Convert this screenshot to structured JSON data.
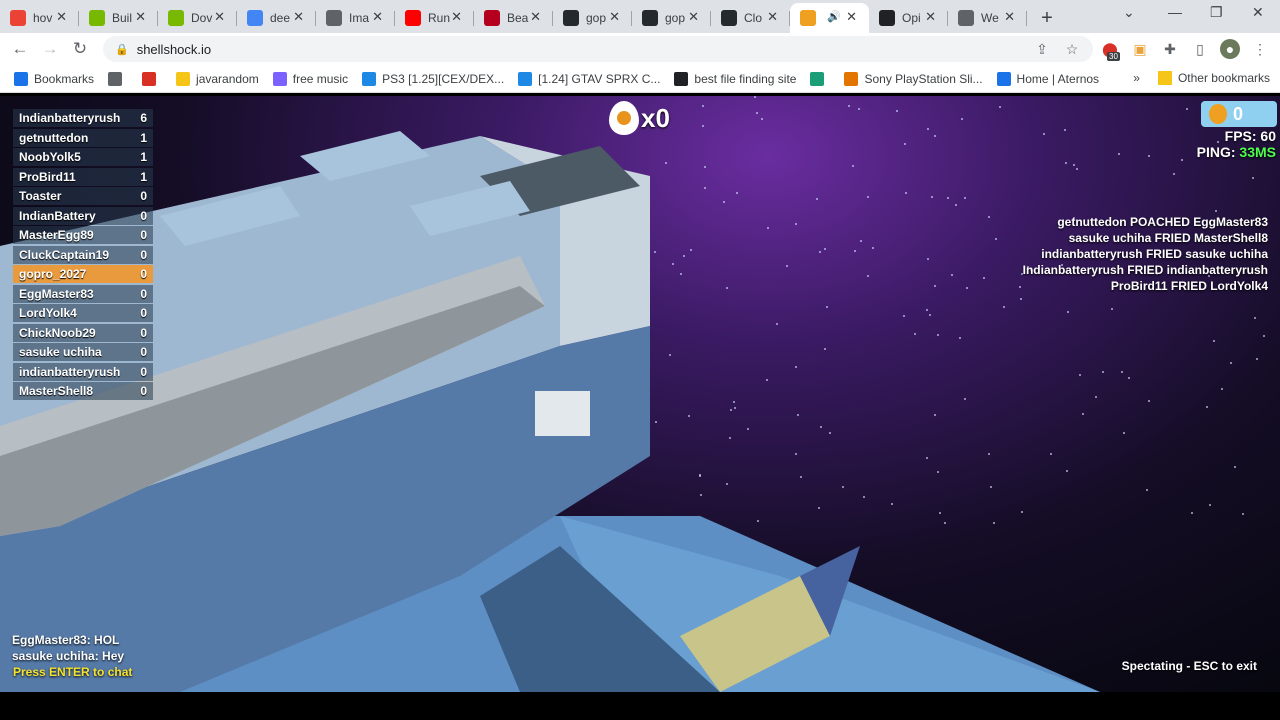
{
  "tabs": [
    {
      "label": "hov",
      "favicon": "google-photos-icon",
      "color": "#ea4335"
    },
    {
      "label": "Buil",
      "favicon": "nvidia-icon",
      "color": "#76b900"
    },
    {
      "label": "Dov",
      "favicon": "nvidia-icon",
      "color": "#76b900"
    },
    {
      "label": "dee",
      "favicon": "google-icon",
      "color": "#4285f4"
    },
    {
      "label": "Ima",
      "favicon": "chart-icon",
      "color": "#5f6368"
    },
    {
      "label": "Run",
      "favicon": "youtube-icon",
      "color": "#ff0000"
    },
    {
      "label": "Bea",
      "favicon": "m-icon",
      "color": "#b4001e"
    },
    {
      "label": "gop",
      "favicon": "github-icon",
      "color": "#24292e"
    },
    {
      "label": "gop",
      "favicon": "github-icon",
      "color": "#24292e"
    },
    {
      "label": "Clo",
      "favicon": "github-icon",
      "color": "#24292e"
    },
    {
      "label": "",
      "favicon": "shellshock-icon",
      "color": "#f0a020",
      "active": true
    },
    {
      "label": "Opi",
      "favicon": "openai-icon",
      "color": "#202124"
    },
    {
      "label": "We",
      "favicon": "globe-icon",
      "color": "#5f6368"
    }
  ],
  "address_bar": {
    "url": "shellshock.io"
  },
  "extension_badge": "30",
  "bookmarks": [
    {
      "label": "Bookmarks",
      "icon": "star-icon",
      "color": "#1a73e8"
    },
    {
      "label": "",
      "icon": "globe-icon",
      "color": "#5f6368"
    },
    {
      "label": "",
      "icon": "heart-icon",
      "color": "#d93025"
    },
    {
      "label": "javarandom",
      "icon": "folder-icon",
      "color": "#f5c518"
    },
    {
      "label": "free music",
      "icon": "diamond-icon",
      "color": "#7b61ff"
    },
    {
      "label": "PS3 [1.25][CEX/DEX...",
      "icon": "c-icon",
      "color": "#1e88e5"
    },
    {
      "label": "[1.24] GTAV SPRX C...",
      "icon": "c-icon",
      "color": "#1e88e5"
    },
    {
      "label": "best file finding site",
      "icon": "robot-icon",
      "color": "#202124"
    },
    {
      "label": "",
      "icon": "app-icon",
      "color": "#1b9e77"
    },
    {
      "label": "Sony PlayStation Sli...",
      "icon": "bag-icon",
      "color": "#e37400"
    },
    {
      "label": "Home | Aternos",
      "icon": "aternos-icon",
      "color": "#1a73e8"
    }
  ],
  "other_bookmarks": "Other bookmarks",
  "leaderboard": [
    {
      "name": "Indianbatteryrush",
      "score": "6"
    },
    {
      "name": "getnuttedon",
      "score": "1"
    },
    {
      "name": "NoobYolk5",
      "score": "1"
    },
    {
      "name": "ProBird11",
      "score": "1"
    },
    {
      "name": "Toaster",
      "score": "0"
    },
    {
      "name": "IndianBattery",
      "score": "0"
    },
    {
      "name": "MasterEgg89",
      "score": "0"
    },
    {
      "name": "CluckCaptain19",
      "score": "0"
    },
    {
      "name": "gopro_2027",
      "score": "0",
      "self": true
    },
    {
      "name": "EggMaster83",
      "score": "0"
    },
    {
      "name": "LordYolk4",
      "score": "0"
    },
    {
      "name": "ChickNoob29",
      "score": "0"
    },
    {
      "name": "sasuke uchiha",
      "score": "0"
    },
    {
      "name": "indianbatteryrush",
      "score": "0"
    },
    {
      "name": "MasterShell8",
      "score": "0"
    }
  ],
  "hud": {
    "egg_multiplier": "x0",
    "coins": "0",
    "fps_label": "FPS:",
    "fps": "60",
    "ping_label": "PING:",
    "ping": "33MS"
  },
  "killfeed": [
    "getnuttedon POACHED EggMaster83",
    "sasuke uchiha FRIED MasterShell8",
    "indianbatteryrush FRIED sasuke uchiha",
    "Indianbatteryrush FRIED indianbatteryrush",
    "ProBird11 FRIED LordYolk4"
  ],
  "chat": [
    "EggMaster83: HOL",
    "sasuke uchiha: Hey"
  ],
  "chat_prompt": "Press ENTER to chat",
  "spectating": "Spectating - ESC to exit"
}
